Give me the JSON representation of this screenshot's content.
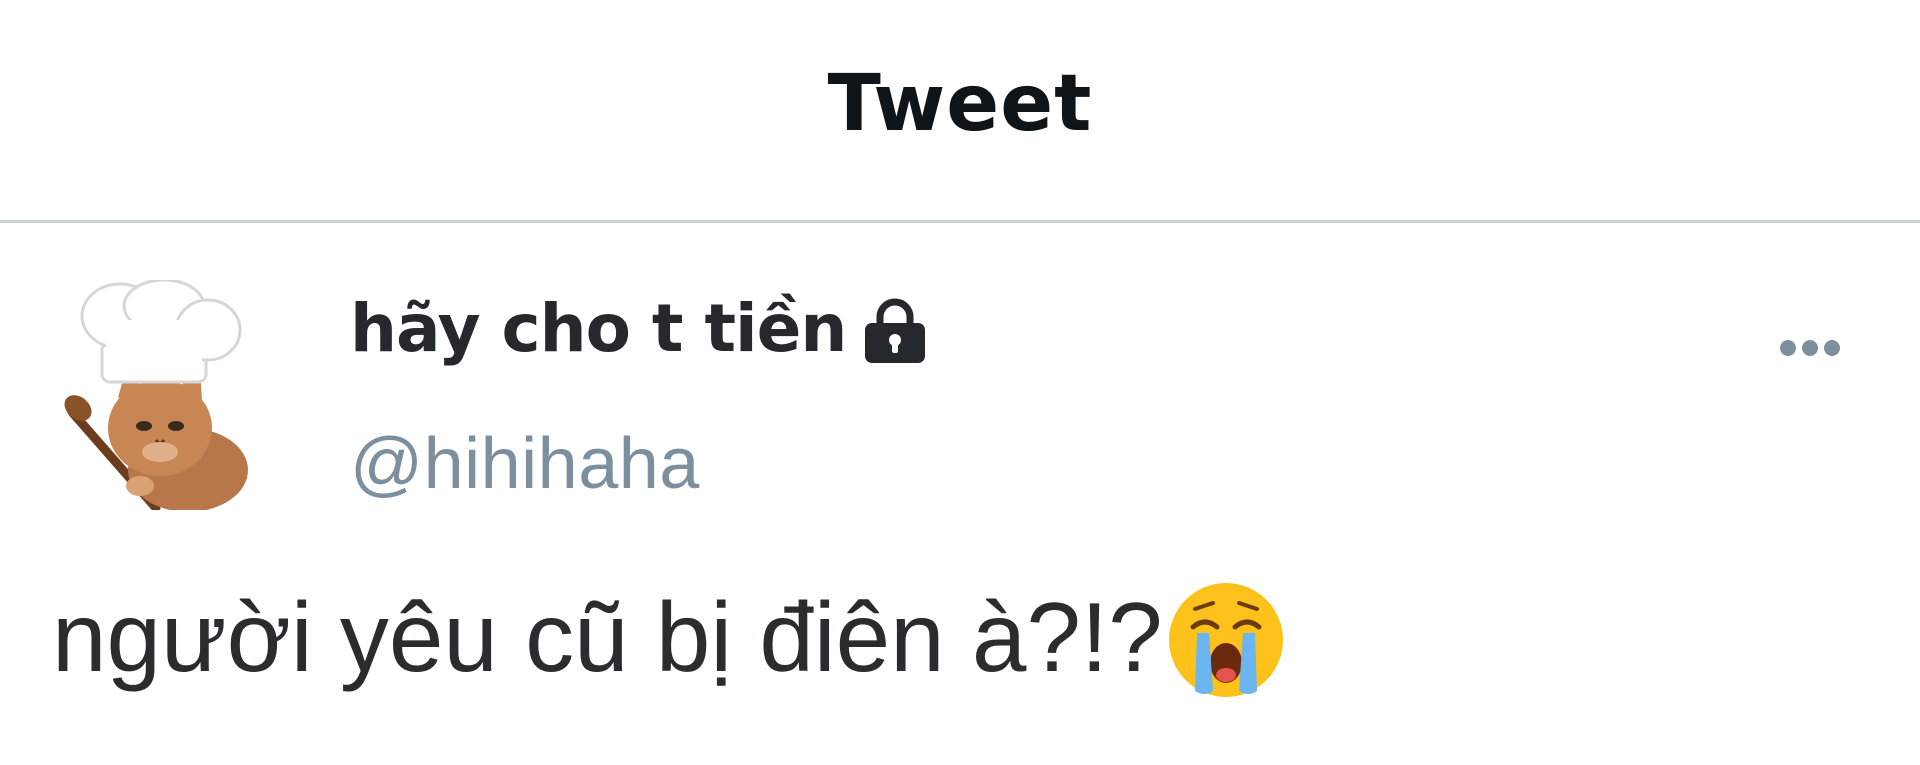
{
  "header": {
    "title": "Tweet"
  },
  "tweet": {
    "author": {
      "display_name": "hãy cho t tiền",
      "handle": "@hihihaha",
      "avatar_icon": "cat-chef-avatar-icon",
      "protected_icon": "lock-icon"
    },
    "more_icon": "more-options-icon",
    "text": "người yêu cũ bị điên à?!?",
    "emoji_icon": "loudly-crying-face-emoji"
  },
  "colors": {
    "title": "#0f1419",
    "name": "#26292c",
    "handle": "#7c8f9e",
    "more_dots": "#7c8f9e",
    "body_text": "#2a2c2e",
    "divider": "#cfd4d8"
  }
}
